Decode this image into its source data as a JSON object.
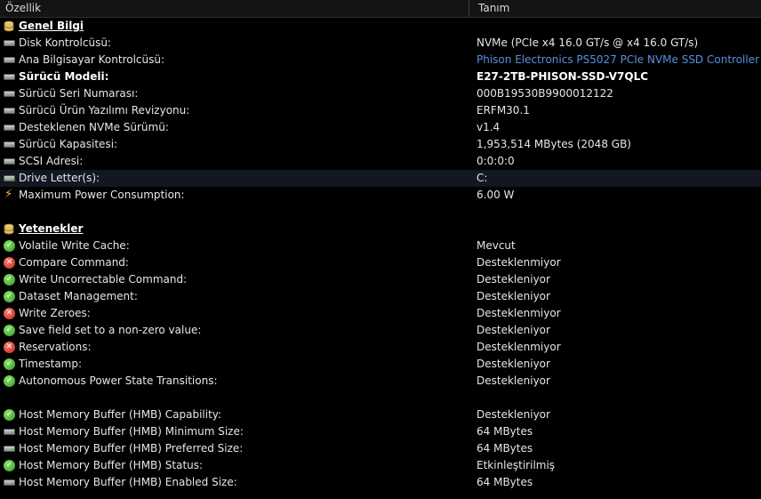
{
  "header": {
    "col1": "Özellik",
    "col2": "Tanım"
  },
  "rows": [
    {
      "type": "section",
      "icon": "database-icon",
      "label": "Genel Bilgi"
    },
    {
      "type": "row",
      "icon": "drive-icon",
      "label": "Disk Kontrolcüsü:",
      "value": "NVMe (PCIe x4 16.0 GT/s @ x4 16.0 GT/s)"
    },
    {
      "type": "row",
      "icon": "drive-icon",
      "label": "Ana Bilgisayar Kontrolcüsü:",
      "value": "Phison Electronics PS5027 PCIe NVMe SSD Controller",
      "link": true
    },
    {
      "type": "row",
      "icon": "drive-icon",
      "label": "Sürücü Modeli:",
      "value": "E27-2TB-PHISON-SSD-V7QLC",
      "bold": true
    },
    {
      "type": "row",
      "icon": "drive-icon",
      "label": "Sürücü Seri Numarası:",
      "value": "000B19530B9900012122"
    },
    {
      "type": "row",
      "icon": "drive-icon",
      "label": "Sürücü Ürün Yazılımı Revizyonu:",
      "value": "ERFM30.1"
    },
    {
      "type": "row",
      "icon": "drive-icon",
      "label": "Desteklenen NVMe Sürümü:",
      "value": "v1.4"
    },
    {
      "type": "row",
      "icon": "drive-icon",
      "label": "Sürücü Kapasitesi:",
      "value": "1,953,514 MBytes (2048 GB)"
    },
    {
      "type": "row",
      "icon": "drive-icon",
      "label": "SCSI Adresi:",
      "value": "0:0:0:0"
    },
    {
      "type": "row",
      "icon": "drive-icon",
      "label": "Drive Letter(s):",
      "value": "C:",
      "highlight": true
    },
    {
      "type": "row",
      "icon": "lightning-icon",
      "label": "Maximum Power Consumption:",
      "value": "6.00 W"
    },
    {
      "type": "spacer"
    },
    {
      "type": "section",
      "icon": "database-icon",
      "label": "Yetenekler"
    },
    {
      "type": "row",
      "icon": "check-icon",
      "label": "Volatile Write Cache:",
      "value": "Mevcut"
    },
    {
      "type": "row",
      "icon": "cross-icon",
      "label": "Compare Command:",
      "value": "Desteklenmiyor"
    },
    {
      "type": "row",
      "icon": "check-icon",
      "label": "Write Uncorrectable Command:",
      "value": "Destekleniyor"
    },
    {
      "type": "row",
      "icon": "check-icon",
      "label": "Dataset Management:",
      "value": "Destekleniyor"
    },
    {
      "type": "row",
      "icon": "cross-icon",
      "label": "Write Zeroes:",
      "value": "Desteklenmiyor"
    },
    {
      "type": "row",
      "icon": "check-icon",
      "label": "Save field set to a non-zero value:",
      "value": "Destekleniyor"
    },
    {
      "type": "row",
      "icon": "cross-icon",
      "label": "Reservations:",
      "value": "Desteklenmiyor"
    },
    {
      "type": "row",
      "icon": "check-icon",
      "label": "Timestamp:",
      "value": "Destekleniyor"
    },
    {
      "type": "row",
      "icon": "check-icon",
      "label": "Autonomous Power State Transitions:",
      "value": "Destekleniyor"
    },
    {
      "type": "spacer"
    },
    {
      "type": "row",
      "icon": "check-icon",
      "label": "Host Memory Buffer (HMB) Capability:",
      "value": "Destekleniyor"
    },
    {
      "type": "row",
      "icon": "drive-icon",
      "label": "Host Memory Buffer (HMB) Minimum Size:",
      "value": "64 MBytes"
    },
    {
      "type": "row",
      "icon": "drive-icon",
      "label": "Host Memory Buffer (HMB) Preferred Size:",
      "value": "64 MBytes"
    },
    {
      "type": "row",
      "icon": "check-icon",
      "label": "Host Memory Buffer (HMB) Status:",
      "value": "Etkinleştirilmiş"
    },
    {
      "type": "row",
      "icon": "drive-icon",
      "label": "Host Memory Buffer (HMB) Enabled Size:",
      "value": "64 MBytes"
    }
  ]
}
